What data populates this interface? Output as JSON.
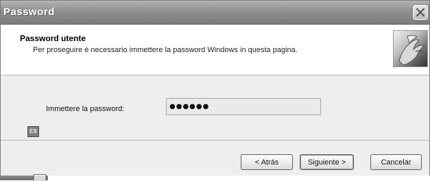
{
  "window": {
    "title": "Password",
    "close_icon": "close-icon"
  },
  "header": {
    "title": "Password utente",
    "subtitle": "Per proseguire è necessario immettere la password Windows in questa pagina.",
    "image_icon": "hands-image"
  },
  "form": {
    "password_label": "Immettere la password:",
    "password_value": "●●●●●●",
    "language_badge": "ES"
  },
  "buttons": {
    "back": "< Atrás",
    "next": "Siguiente >",
    "cancel": "Cancelar"
  },
  "colors": {
    "titlebar": "#8f8f8f",
    "dialog_bg": "#eeeeee"
  }
}
